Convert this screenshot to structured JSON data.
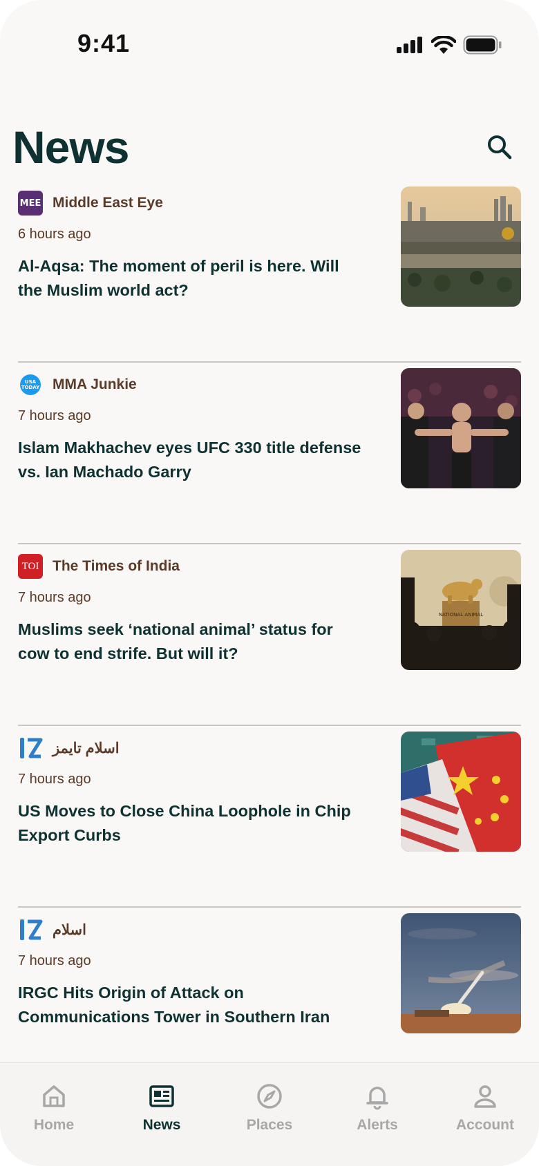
{
  "status_bar": {
    "time": "9:41"
  },
  "header": {
    "title": "News"
  },
  "articles": [
    {
      "source": "Middle East Eye",
      "logo_text": "MEE",
      "time": "6 hours ago",
      "headline": "Al-Aqsa: The moment of peril is here. Will the Muslim world act?"
    },
    {
      "source": "MMA Junkie",
      "logo_text": "USA TODAY",
      "time": "7 hours ago",
      "headline": "Islam Makhachev eyes UFC 330 title defense vs. Ian Machado Garry"
    },
    {
      "source": "The Times of India",
      "logo_text": "TOI",
      "time": "7 hours ago",
      "headline": "Muslims seek ‘national animal’ status for cow to end strife. But will it?"
    },
    {
      "source": "اسلام تایمز",
      "logo_text": "IS",
      "time": "7 hours ago",
      "headline": "US Moves to Close China Loophole in Chip Export Curbs"
    },
    {
      "source": "اسلام",
      "logo_text": "IS",
      "time": "7 hours ago",
      "headline": "IRGC Hits Origin of Attack on Communications Tower in Southern Iran"
    }
  ],
  "thumb_text": {
    "statue_plaque": "NATIONAL ANIMAL"
  },
  "tab_bar": {
    "tabs": [
      {
        "label": "Home",
        "icon": "home-icon",
        "active": false
      },
      {
        "label": "News",
        "icon": "newspaper-icon",
        "active": true
      },
      {
        "label": "Places",
        "icon": "compass-icon",
        "active": false
      },
      {
        "label": "Alerts",
        "icon": "bell-icon",
        "active": false
      },
      {
        "label": "Account",
        "icon": "person-icon",
        "active": false
      }
    ]
  },
  "colors": {
    "background": "#faf8f6",
    "title": "#0e3232",
    "source_text": "#5a3a28",
    "tab_inactive": "#a7a7a7",
    "divider": "#c9c6c2"
  }
}
